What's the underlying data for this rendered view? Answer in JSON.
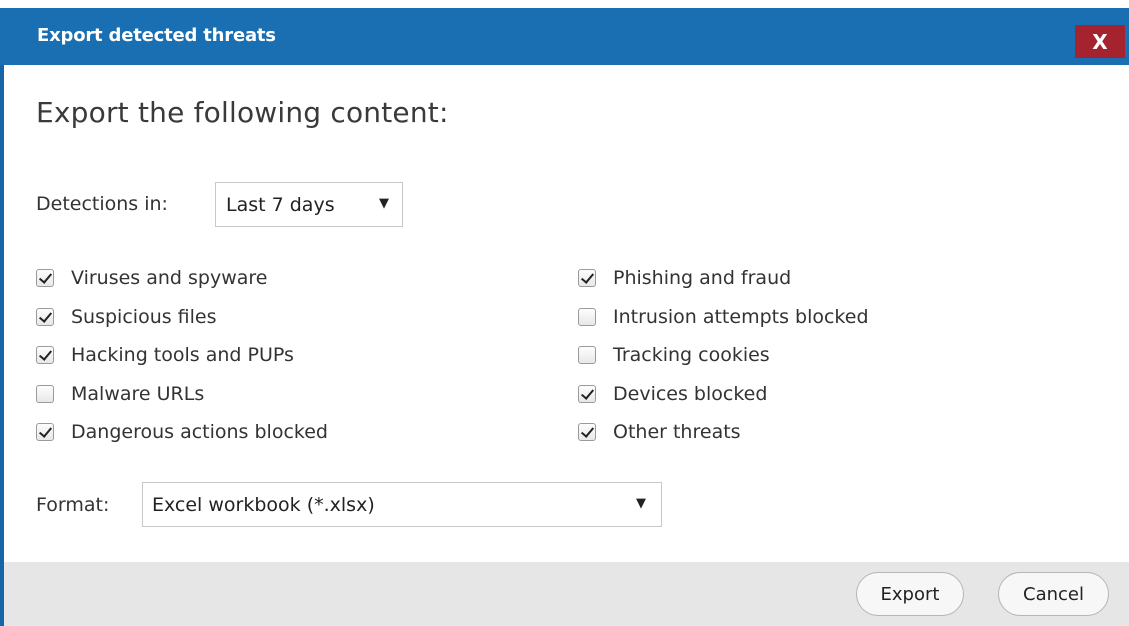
{
  "dialog": {
    "title": "Export detected threats",
    "close_label": "X",
    "heading": "Export the following content:"
  },
  "detections": {
    "label": "Detections in:",
    "selected": "Last 7 days",
    "arrow": "▼"
  },
  "options_left": [
    {
      "label": "Viruses and spyware",
      "checked": true
    },
    {
      "label": "Suspicious files",
      "checked": true
    },
    {
      "label": "Hacking tools and PUPs",
      "checked": true
    },
    {
      "label": "Malware URLs",
      "checked": false
    },
    {
      "label": "Dangerous actions blocked",
      "checked": true
    }
  ],
  "options_right": [
    {
      "label": "Phishing and fraud",
      "checked": true
    },
    {
      "label": "Intrusion attempts blocked",
      "checked": false
    },
    {
      "label": "Tracking cookies",
      "checked": false
    },
    {
      "label": "Devices blocked",
      "checked": true
    },
    {
      "label": "Other threats",
      "checked": true
    }
  ],
  "format": {
    "label": "Format:",
    "selected": "Excel workbook (*.xlsx)",
    "arrow": "▼"
  },
  "buttons": {
    "export": "Export",
    "cancel": "Cancel"
  },
  "colors": {
    "titlebar": "#1a6fb2",
    "close_button": "#a4232e",
    "footer": "#e6e6e6"
  }
}
